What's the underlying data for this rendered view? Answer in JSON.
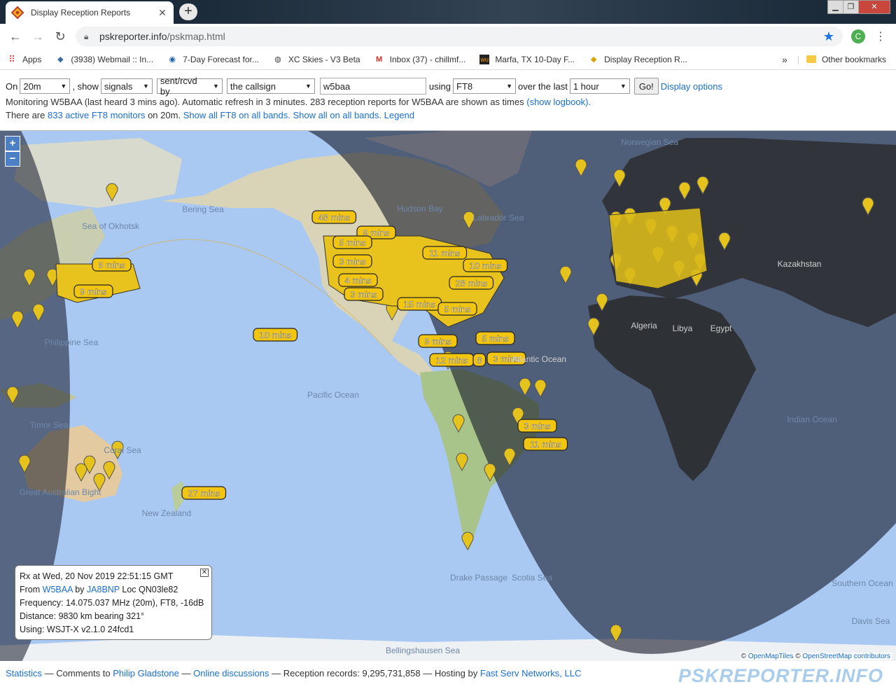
{
  "browser": {
    "tab_title": "Display Reception Reports",
    "url_host": "pskreporter.info",
    "url_path": "/pskmap.html",
    "profile_initial": "C",
    "bookmarks": [
      {
        "label": "Apps",
        "icon": "apps-grid-icon"
      },
      {
        "label": "(3938) Webmail :: In...",
        "icon": "webmail-icon"
      },
      {
        "label": "7-Day Forecast for...",
        "icon": "noaa-icon"
      },
      {
        "label": "XC Skies - V3 Beta",
        "icon": "globe-icon"
      },
      {
        "label": "Inbox (37) - chillmf...",
        "icon": "gmail-icon"
      },
      {
        "label": "Marfa, TX 10-Day F...",
        "icon": "weather-icon"
      },
      {
        "label": "Display Reception R...",
        "icon": "pskreporter-icon"
      }
    ],
    "bookmarks_overflow": "»",
    "other_bookmarks": "Other bookmarks"
  },
  "controls": {
    "on_label": "On",
    "band": "20m",
    "show_label": ", show",
    "show_value": "signals",
    "direction": "sent/rcvd by",
    "target": "the callsign",
    "callsign": "w5baa",
    "using_label": "using",
    "mode": "FT8",
    "over_label": "over the last",
    "period": "1 hour",
    "go": "Go!",
    "display_options": "Display options"
  },
  "status": {
    "monitoring": "Monitoring W5BAA (last heard 3 mins ago). Automatic refresh in 3 minutes. 283 reception reports for W5BAA are shown as times",
    "show_logbook": "(show logbook).",
    "there_are": "There are",
    "active_monitors": "833 active FT8 monitors",
    "on_band": "on 20m.",
    "show_all_ft8": "Show all FT8 on all bands.",
    "show_all": "Show all on all bands.",
    "legend": "Legend"
  },
  "map": {
    "zoom_in": "+",
    "zoom_out": "−",
    "labels": [
      "48 mins",
      "9 mins",
      "5 mins",
      "3 mins",
      "4 mins",
      "3 mins",
      "15 mins",
      "5 mins",
      "11 mins",
      "10 mins",
      "28 mins",
      "6 mins",
      "9 mins",
      "10 mins",
      "9 mins",
      "5 mins",
      "12 mins",
      "8",
      "3 mins",
      "3 mins",
      "11 mins",
      "27 mins"
    ],
    "place_names": [
      "Norwegian Sea",
      "Hudson Bay",
      "Labrador Sea",
      "Sea of Okhotsk",
      "Bering Sea",
      "Philippine Sea",
      "Pacific Ocean",
      "Timor Sea",
      "Coral Sea",
      "Great Australian Bight",
      "New Zealand",
      "Drake Passage",
      "Scotia Sea",
      "Southern Ocean",
      "Davis Sea",
      "Indian Ocean",
      "Bellingshausen Sea",
      "Kazakhstan",
      "Algeria",
      "Libya",
      "Egypt",
      "Atlantic Ocean"
    ],
    "attribution_pre": "©",
    "attribution_tiles": "OpenMapTiles",
    "attribution_mid": "©",
    "attribution_osm": "OpenStreetMap contributors"
  },
  "infobox": {
    "line1": "Rx at Wed, 20 Nov 2019 22:51:15 GMT",
    "from_label": "From",
    "from_call": "W5BAA",
    "by_label": "by",
    "by_call": "JA8BNP",
    "loc": "Loc QN03le82",
    "frequency": "Frequency: 14.075.037 MHz (20m), FT8, -16dB",
    "distance": "Distance: 9830 km bearing 321°",
    "using": "Using: WSJT-X v2.1.0 24fcd1"
  },
  "footer": {
    "statistics": "Statistics",
    "comments": "— Comments to",
    "author": "Philip Gladstone",
    "sep1": "—",
    "discussions": "Online discussions",
    "records": "— Reception records: 9,295,731,858 — Hosting by",
    "host": "Fast Serv Networks, LLC",
    "logo": "PSKREPORTER.INFO"
  }
}
